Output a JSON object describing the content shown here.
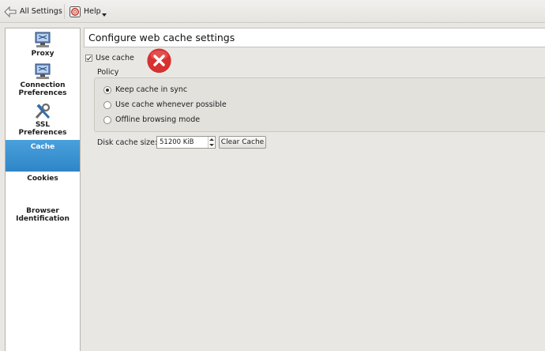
{
  "toolbar": {
    "all_settings_label": "All Settings",
    "help_label": "Help"
  },
  "sidebar": {
    "items": [
      {
        "label": "Proxy",
        "icon": "proxy-icon",
        "selected": false
      },
      {
        "label": "Connection\nPreferences",
        "icon": "connection-icon",
        "selected": false
      },
      {
        "label": "SSL\nPreferences",
        "icon": "tools-icon",
        "selected": false
      },
      {
        "label": "Cache",
        "icon": "",
        "selected": true
      },
      {
        "label": "Cookies",
        "icon": "",
        "selected": false
      },
      {
        "label": "Browser\nIdentification",
        "icon": "",
        "selected": false
      }
    ]
  },
  "main": {
    "title": "Configure web cache settings",
    "use_cache": {
      "label": "Use cache",
      "checked": true
    },
    "policy": {
      "label": "Policy",
      "options": [
        {
          "label": "Keep cache in sync",
          "selected": true
        },
        {
          "label": "Use cache whenever possible",
          "selected": false
        },
        {
          "label": "Offline browsing mode",
          "selected": false
        }
      ]
    },
    "disk_cache": {
      "label": "Disk cache size:",
      "value": "51200 KiB"
    },
    "clear_cache_label": "Clear Cache"
  },
  "colors": {
    "selected_bg": "#3a92d1",
    "error_red": "#d42a2a"
  }
}
